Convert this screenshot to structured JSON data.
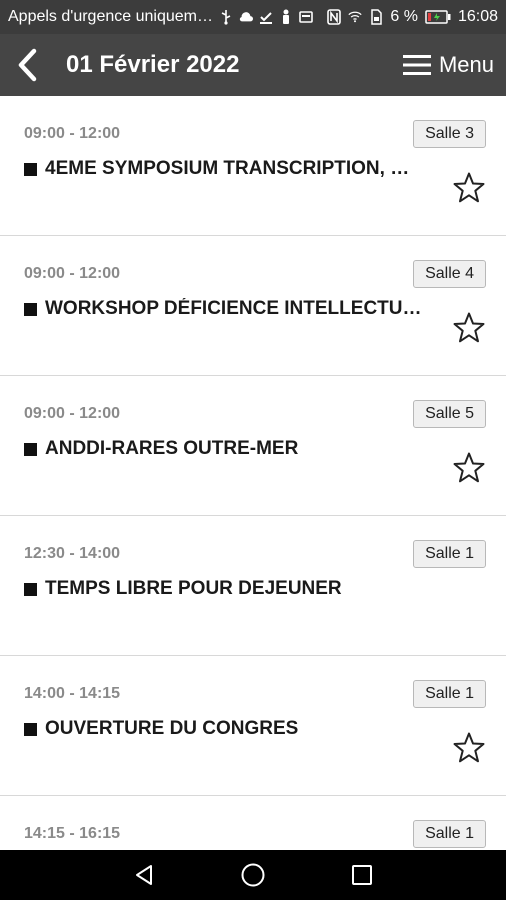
{
  "status_bar": {
    "carrier_text": "Appels d'urgence uniquem…",
    "battery_percent": "6 %",
    "time": "16:08"
  },
  "header": {
    "title": "01 Février 2022",
    "menu_label": "Menu"
  },
  "sessions": [
    {
      "time": "09:00 - 12:00",
      "room": "Salle 3",
      "title": "4EME SYMPOSIUM TRANSCRIPTION, …",
      "favorite_visible": true
    },
    {
      "time": "09:00 - 12:00",
      "room": "Salle 4",
      "title": "WORKSHOP DÉFICIENCE INTELLECTU…",
      "favorite_visible": true
    },
    {
      "time": "09:00 - 12:00",
      "room": "Salle 5",
      "title": "ANDDI-RARES OUTRE-MER",
      "favorite_visible": true
    },
    {
      "time": "12:30 - 14:00",
      "room": "Salle 1",
      "title": "TEMPS LIBRE POUR DEJEUNER",
      "favorite_visible": false
    },
    {
      "time": "14:00 - 14:15",
      "room": "Salle 1",
      "title": "OUVERTURE DU CONGRES",
      "favorite_visible": true
    },
    {
      "time": "14:15 - 16:15",
      "room": "Salle 1",
      "title": "",
      "favorite_visible": false
    }
  ],
  "colors": {
    "header_bg": "#454545",
    "status_bg": "#3c3c3c",
    "time_text": "#8a8a8a"
  }
}
